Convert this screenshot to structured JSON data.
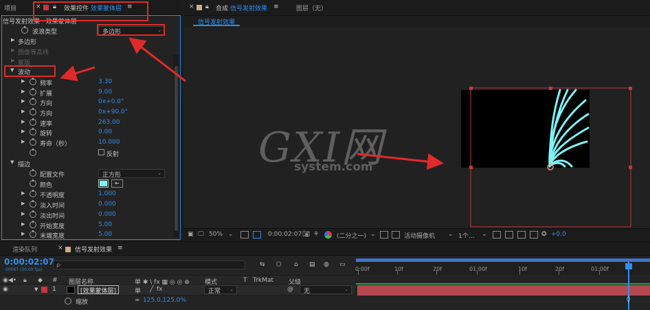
{
  "left_tabs": {
    "project": "项目",
    "fx_controls_prefix": "效果控件",
    "fx_controls_layer": "效果蒙体层",
    "menu": "≡"
  },
  "fx_panel": {
    "breadcrumb": "信号发射效果 · 效果蒙体层",
    "wave_type_label": "波浪类型",
    "wave_type_value": "多边形",
    "polygon_label": "多边形",
    "image_contour_label": "图像等高线",
    "mask_label": "蒙版",
    "motion_label": "波动",
    "props": [
      {
        "label": "频率",
        "value": "3.30"
      },
      {
        "label": "扩展",
        "value": "9.00"
      },
      {
        "label": "方向",
        "value": "0x+0.0°"
      },
      {
        "label": "方向",
        "value": "0x+90.0°"
      },
      {
        "label": "速率",
        "value": "263.00"
      },
      {
        "label": "旋转",
        "value": "0.00"
      },
      {
        "label": "寿命（秒）",
        "value": "10.000"
      }
    ],
    "reflect_label": "反射",
    "stroke_label": "描边",
    "profile_label": "配置文件",
    "profile_value": "正方形",
    "color_label": "颜色",
    "color_swatch": "#7ff2f6",
    "stroke_props": [
      {
        "label": "不透明度",
        "value": "1.000"
      },
      {
        "label": "淡入时间",
        "value": "0.000"
      },
      {
        "label": "淡出时间",
        "value": "0.000"
      },
      {
        "label": "开始宽度",
        "value": "5.00"
      },
      {
        "label": "末端宽度",
        "value": "5.00"
      }
    ]
  },
  "comp_tabs": {
    "comp_prefix": "合成",
    "comp_name": "信号发射效果",
    "menu": "≡",
    "layer_tab": "图层（无）",
    "subtab": "信号发射效果"
  },
  "watermark": {
    "logo_letters": "GXI网",
    "site": "system.com"
  },
  "comp_toolbar": {
    "zoom": "50%",
    "timecode": "0:00:02:07",
    "resolution": "(二分之一)",
    "camera": "活动摄像机",
    "views": "1个…",
    "exposure": "+0.0"
  },
  "timeline": {
    "render_queue_tab": "渲染队列",
    "comp_tab": "信号发射效果",
    "menu": "≡",
    "timecode": "0:00:02:07",
    "frame_info": "00067 (30.00 fps)",
    "search_placeholder": "ρ·",
    "col_number": "#",
    "col_layer_name": "图层名称",
    "col_switches": "单 ✱ \\ fx ▦ ◎ ◎ ⊕",
    "col_mode": "模式",
    "col_t": "T",
    "col_trkmat": "TrkMat",
    "col_parent": "父级",
    "layer_index": "1",
    "layer_name": "[效果蒙体层]",
    "layer_mode": "正常",
    "layer_parent": "无",
    "scale_label": "缩放",
    "scale_value": "125.0,125.0%",
    "ruler_labels": [
      "0:00f",
      "10f",
      "20f",
      "01:00f",
      "10f",
      "20f",
      "01:00f"
    ]
  },
  "colors": {
    "accent": "#2f8ef0",
    "annotation_red": "#e02a2a",
    "layer_bar": "#b5474f",
    "work_area": "#3f77c9",
    "wave_cyan": "#7ff2f6"
  }
}
